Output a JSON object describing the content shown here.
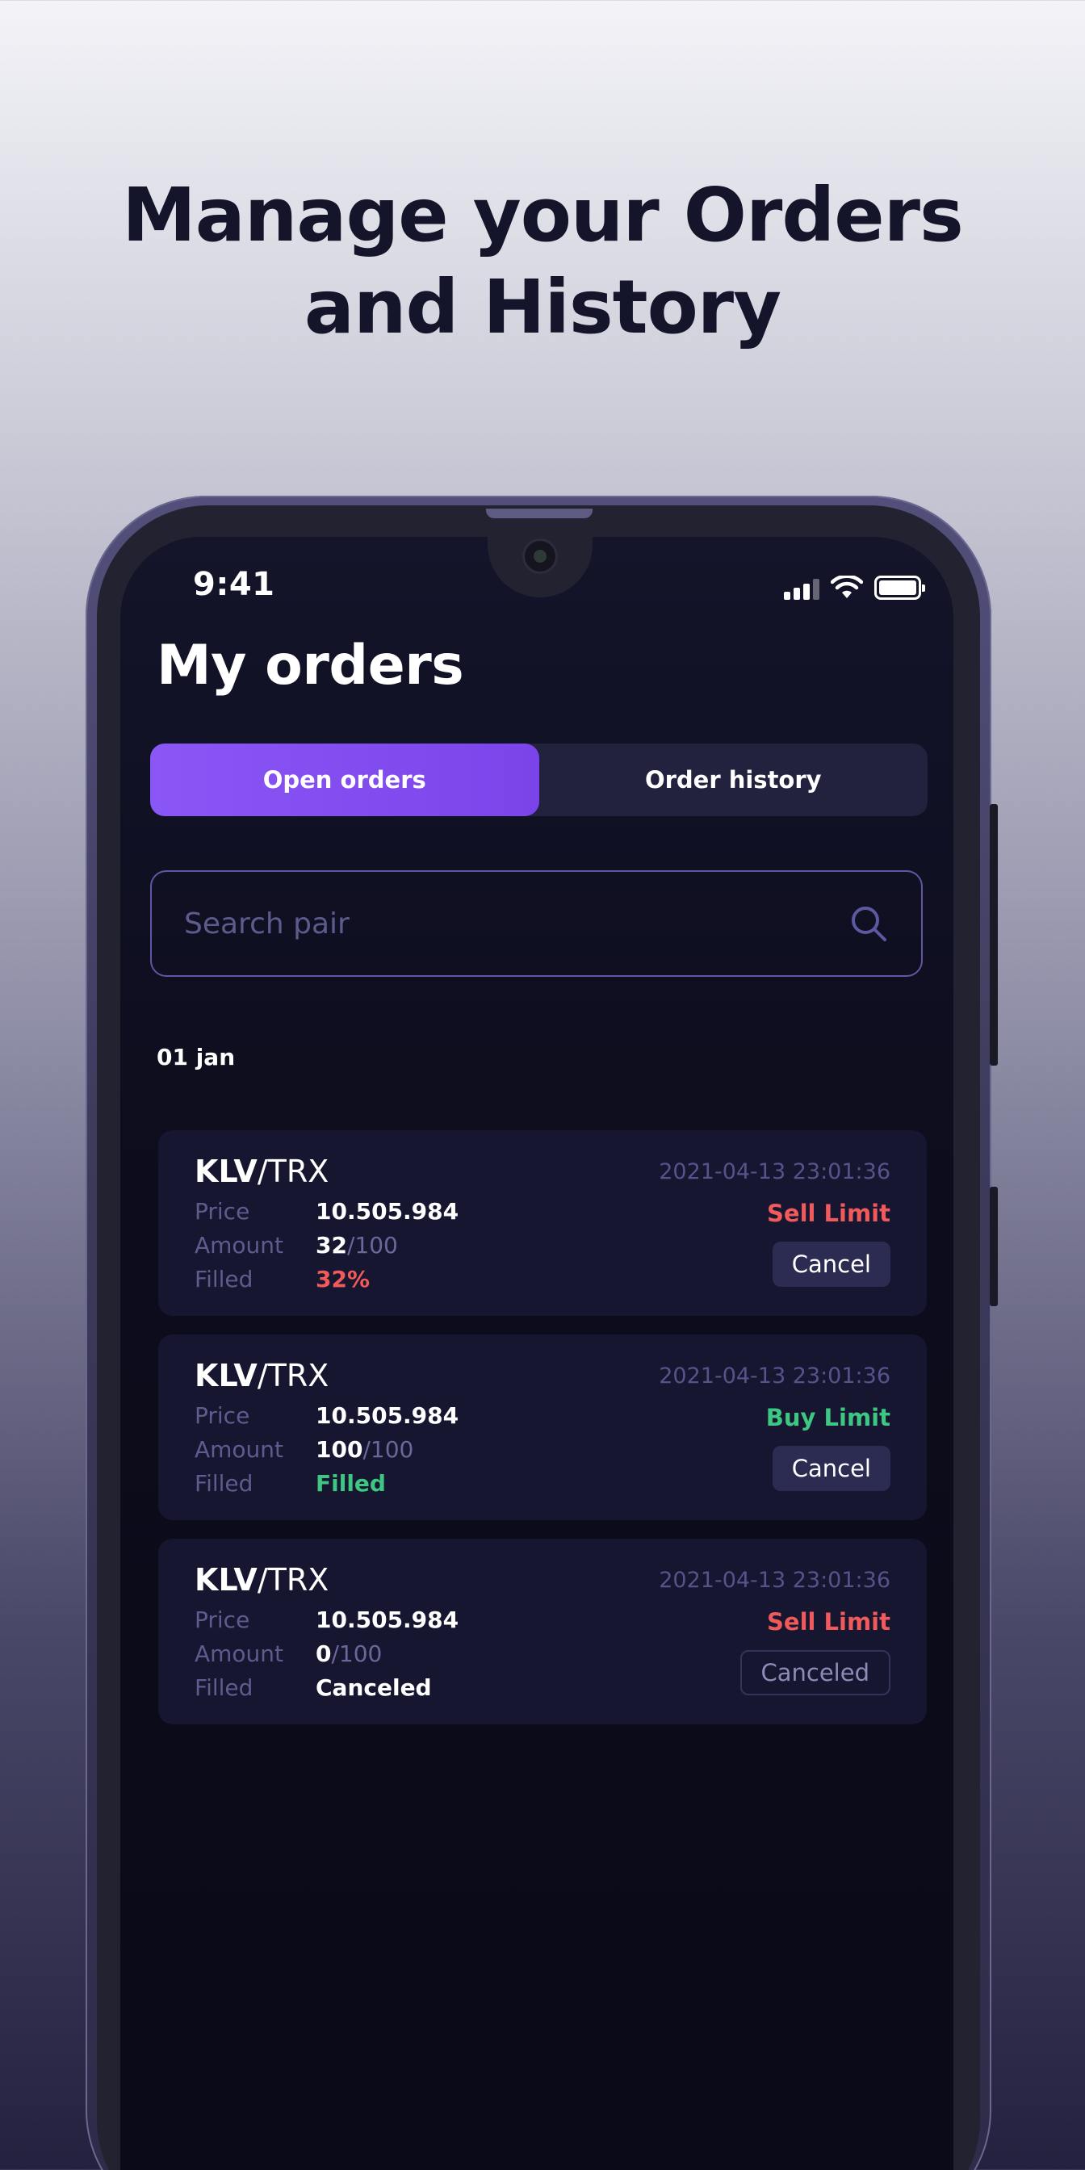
{
  "headline": {
    "line1": "Manage your Orders",
    "line2": "and History"
  },
  "status_bar": {
    "time": "9:41",
    "icons": [
      "signal-icon",
      "wifi-icon",
      "battery-icon"
    ]
  },
  "page": {
    "title": "My orders"
  },
  "tabs": [
    {
      "label": "Open orders",
      "active": true
    },
    {
      "label": "Order history",
      "active": false
    }
  ],
  "search": {
    "placeholder": "Search pair",
    "value": ""
  },
  "date_group": "01 jan",
  "labels": {
    "price": "Price",
    "amount": "Amount",
    "filled": "Filled"
  },
  "orders": [
    {
      "base": "KLV",
      "quote": "/TRX",
      "timestamp": "2021-04-13 23:01:36",
      "side": "Sell Limit",
      "price": "10.505.984",
      "amount_filled": "32",
      "amount_total": "/100",
      "filled": "32%",
      "action": "Cancel"
    },
    {
      "base": "KLV",
      "quote": "/TRX",
      "timestamp": "2021-04-13 23:01:36",
      "side": "Buy Limit",
      "price": "10.505.984",
      "amount_filled": "100",
      "amount_total": "/100",
      "filled": "Filled",
      "action": "Cancel"
    },
    {
      "base": "KLV",
      "quote": "/TRX",
      "timestamp": "2021-04-13 23:01:36",
      "side": "Sell Limit",
      "price": "10.505.984",
      "amount_filled": "0",
      "amount_total": "/100",
      "filled": "Canceled",
      "action": "Canceled"
    }
  ],
  "colors": {
    "accent": "#8b56f6",
    "sell": "#f05a5a",
    "buy": "#3ec683",
    "card": "#161630",
    "muted": "#5e5c8e"
  }
}
